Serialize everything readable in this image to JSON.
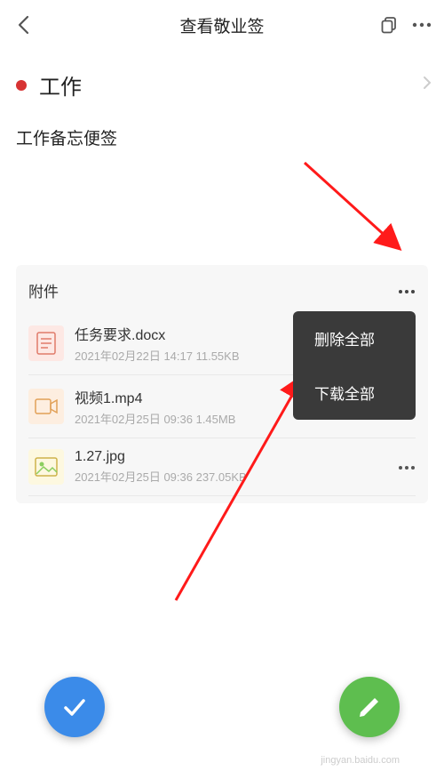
{
  "header": {
    "title": "查看敬业签"
  },
  "category": {
    "name": "工作"
  },
  "note": {
    "title": "工作备忘便签"
  },
  "attachments": {
    "label": "附件",
    "items": [
      {
        "name": "任务要求.docx",
        "meta": "2021年02月22日 14:17  11.55KB"
      },
      {
        "name": "视频1.mp4",
        "meta": "2021年02月25日 09:36  1.45MB"
      },
      {
        "name": "1.27.jpg",
        "meta": "2021年02月25日 09:36  237.05KB"
      }
    ]
  },
  "popup": {
    "delete_all": "删除全部",
    "download_all": "下载全部"
  },
  "watermark": "jingyan.baidu.com"
}
